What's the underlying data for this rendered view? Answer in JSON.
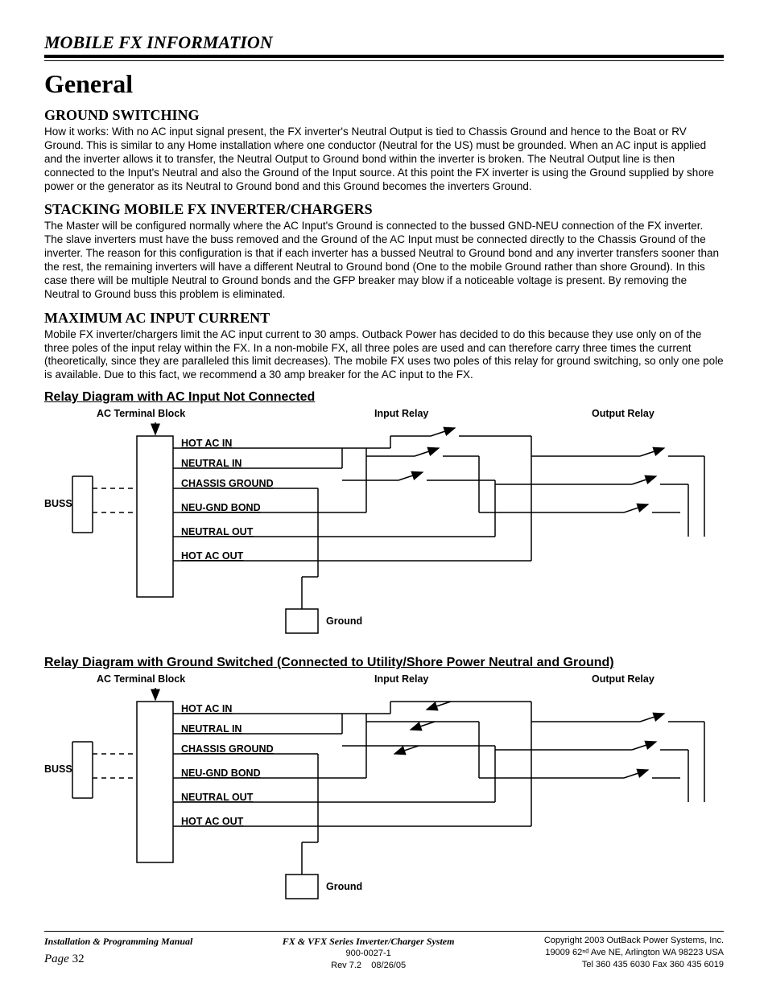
{
  "header": "MOBILE FX INFORMATION",
  "h1": "General",
  "sections": {
    "s1": {
      "title": "GROUND SWITCHING",
      "body": "How it works: With no AC input signal present, the FX inverter's Neutral Output is tied to Chassis Ground and hence to the Boat or RV Ground.  This is similar to any Home installation where one conductor (Neutral for the US) must be grounded.  When an AC input is applied and the inverter allows it to transfer, the Neutral Output to Ground bond within the inverter is broken.  The Neutral Output line is then connected to the Input's Neutral and also the Ground of the Input source.  At this point the FX inverter is using the Ground supplied by shore power or the generator as its Neutral to Ground bond and this Ground becomes the inverters Ground."
    },
    "s2": {
      "title": "STACKING MOBILE FX INVERTER/CHARGERS",
      "body": "The Master will be configured normally where the AC Input's Ground is connected to the bussed GND-NEU connection of the FX inverter.  The slave inverters must have the buss removed and the Ground of the AC Input must be connected directly to the Chassis Ground of the inverter.  The reason for this configuration is that if each inverter has a bussed Neutral to Ground bond and any inverter transfers sooner than the rest, the remaining inverters will have a different Neutral to Ground bond (One to the mobile Ground rather than shore Ground).  In this case there will be multiple Neutral to Ground bonds and the GFP breaker may blow if a noticeable voltage is present.  By removing the Neutral to Ground buss this problem is eliminated."
    },
    "s3": {
      "title": "MAXIMUM AC INPUT CURRENT",
      "body": "Mobile FX inverter/chargers limit the AC input current to 30 amps.  Outback Power has decided to do this because they use only on of the three poles of the input relay within the FX.  In a non-mobile FX, all three poles are used and can therefore carry three times the current (theoretically, since they are paralleled this limit decreases).  The mobile FX uses two poles of this relay for ground switching, so only one pole is available.  Due to this fact, we recommend a 30 amp breaker for the AC input to the FX."
    }
  },
  "diagrams": {
    "d1": {
      "title": "Relay Diagram with AC Input Not Connected",
      "labels": {
        "ac_terminal": "AC Terminal Block",
        "input_relay": "Input Relay",
        "output_relay": "Output Relay",
        "buss": "BUSS",
        "hot_ac_in": "HOT AC IN",
        "neutral_in": "NEUTRAL IN",
        "chassis_ground": "CHASSIS GROUND",
        "neu_gnd_bond": "NEU-GND BOND",
        "neutral_out": "NEUTRAL OUT",
        "hot_ac_out": "HOT AC OUT",
        "ground": "Ground"
      }
    },
    "d2": {
      "title": "Relay Diagram with Ground Switched (Connected to Utility/Shore Power Neutral and Ground)",
      "labels": {
        "ac_terminal": "AC Terminal Block",
        "input_relay": "Input Relay",
        "output_relay": "Output Relay",
        "buss": "BUSS",
        "hot_ac_in": "HOT AC IN",
        "neutral_in": "NEUTRAL IN",
        "chassis_ground": "CHASSIS GROUND",
        "neu_gnd_bond": "NEU-GND BOND",
        "neutral_out": "NEUTRAL OUT",
        "hot_ac_out": "HOT AC OUT",
        "ground": "Ground"
      }
    }
  },
  "footer": {
    "left1": "Installation & Programming Manual",
    "mid1": "FX & VFX Series Inverter/Charger System",
    "mid2": "900-0027-1",
    "mid3_a": "Rev 7.2",
    "mid3_b": "08/26/05",
    "right1": "Copyright 2003      OutBack Power Systems, Inc.",
    "right2": "19009 62ⁿᵈ Ave NE, Arlington  WA 98223 USA",
    "right3": "Tel 360 435 6030    Fax 360 435 6019",
    "page_label": "Page",
    "page_num": "32"
  }
}
